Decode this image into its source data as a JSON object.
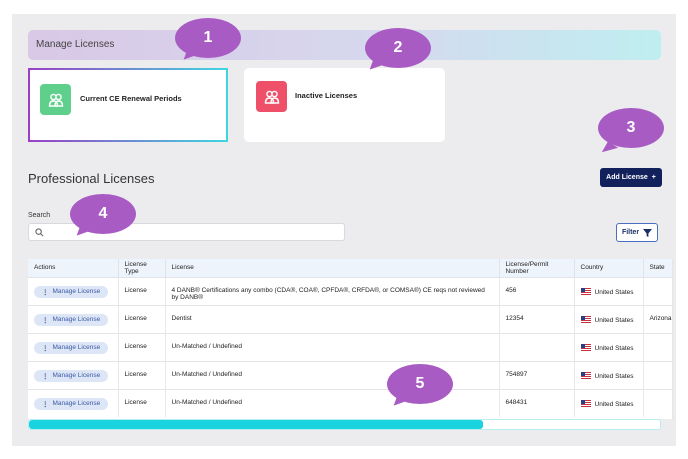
{
  "banner": {
    "title": "Manage Licenses"
  },
  "cards": [
    {
      "label": "Current CE Renewal Periods",
      "icon": "users-icon",
      "color": "#5fd08b"
    },
    {
      "label": "Inactive Licenses",
      "icon": "users-icon",
      "color": "#ee4f69"
    }
  ],
  "section": {
    "title": "Professional Licenses",
    "add_label": "Add License",
    "add_icon": "+"
  },
  "search": {
    "label": "Search",
    "value": "",
    "placeholder": ""
  },
  "filter": {
    "label": "Filter",
    "icon": "funnel-icon"
  },
  "table": {
    "columns": [
      "Actions",
      "License Type",
      "License",
      "License/Permit Number",
      "Country",
      "State"
    ],
    "rows": [
      {
        "action": "Manage License",
        "type": "License",
        "license": "4 DANB® Certifications any combo (CDA®, COA®, CPFDA®, CRFDA®, or COMSA®) CE reqs not reviewed by DANB®",
        "number": "456",
        "country": "United States",
        "state": ""
      },
      {
        "action": "Manage License",
        "type": "License",
        "license": "Dentist",
        "number": "12354",
        "country": "United States",
        "state": "Arizona"
      },
      {
        "action": "Manage License",
        "type": "License",
        "license": "Un-Matched / Undefined",
        "number": "",
        "country": "United States",
        "state": ""
      },
      {
        "action": "Manage License",
        "type": "License",
        "license": "Un-Matched / Undefined",
        "number": "754897",
        "country": "United States",
        "state": ""
      },
      {
        "action": "Manage License",
        "type": "License",
        "license": "Un-Matched / Undefined",
        "number": "648431",
        "country": "United States",
        "state": ""
      }
    ]
  },
  "scrollbar": {
    "position_fraction": 0.72
  },
  "callouts": [
    "1",
    "2",
    "3",
    "4",
    "5"
  ],
  "colors": {
    "accent": "#12215c",
    "callout": "#a95bc4",
    "scroll": "#19d3df"
  }
}
